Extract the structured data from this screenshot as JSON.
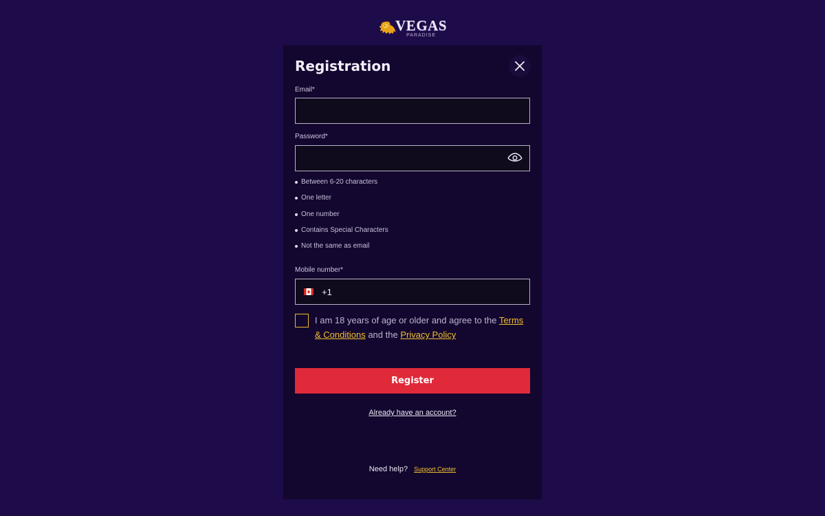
{
  "logo": {
    "main": "VEGAS",
    "sub": "PARADISE"
  },
  "modal": {
    "title": "Registration",
    "close_icon": "close-icon"
  },
  "email": {
    "label": "Email*",
    "value": "",
    "placeholder": ""
  },
  "password": {
    "label": "Password*",
    "value": "",
    "placeholder": "",
    "toggle_icon": "eye-icon",
    "rules": [
      "Between 6-20 characters",
      "One letter",
      "One number",
      "Contains Special Characters",
      "Not the same as email"
    ]
  },
  "mobile": {
    "label": "Mobile number*",
    "country_flag": "canada-flag-icon",
    "dial_code": "+1",
    "value": "",
    "placeholder": ""
  },
  "consent": {
    "text_before": "I am 18 years of age or older and agree to the ",
    "terms_link": "Terms & Conditions",
    "text_middle": " and the ",
    "privacy_link": "Privacy Policy",
    "checked": false
  },
  "register_button": "Register",
  "login_link": "Already have an account?",
  "help": {
    "prompt": "Need help?",
    "link": "Support Center"
  },
  "colors": {
    "page_bg": "#1e0b49",
    "modal_bg": "#13062f",
    "accent": "#f2c12e",
    "register": "#e02a3a"
  }
}
